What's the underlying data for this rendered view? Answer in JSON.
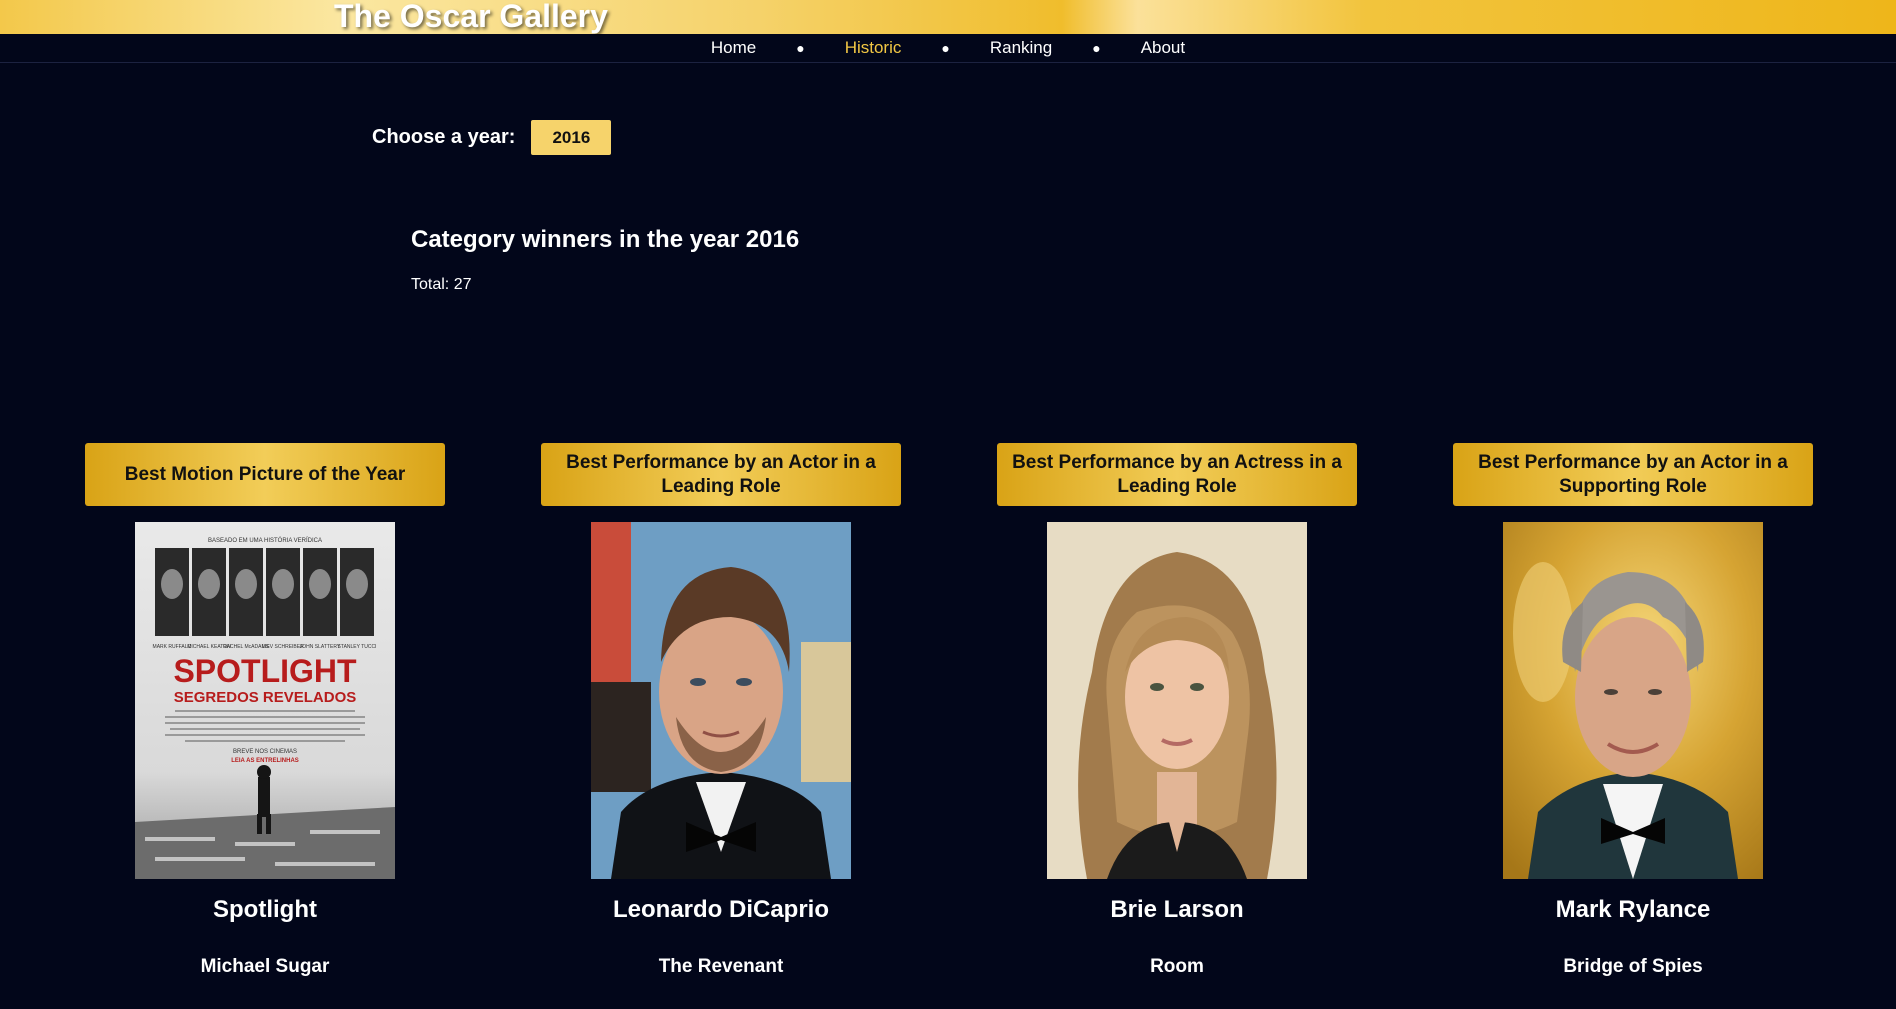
{
  "site": {
    "title": "The Oscar Gallery"
  },
  "nav": {
    "items": [
      {
        "label": "Home",
        "active": false
      },
      {
        "label": "Historic",
        "active": true
      },
      {
        "label": "Ranking",
        "active": false
      },
      {
        "label": "About",
        "active": false
      }
    ]
  },
  "filter": {
    "label": "Choose a year:",
    "selected_year": "2016"
  },
  "results": {
    "title": "Category winners in the year 2016",
    "total": "Total: 27"
  },
  "cards": [
    {
      "category": "Best Motion Picture of the Year",
      "name": "Spotlight",
      "subtitle": "Michael Sugar"
    },
    {
      "category": "Best Performance by an Actor in a Leading Role",
      "name": "Leonardo DiCaprio",
      "subtitle": "The Revenant"
    },
    {
      "category": "Best Performance by an Actress in a Leading Role",
      "name": "Brie Larson",
      "subtitle": "Room"
    },
    {
      "category": "Best Performance by an Actor in a Supporting Role",
      "name": "Mark Rylance",
      "subtitle": "Bridge of Spies"
    }
  ],
  "poster": {
    "top_text": "BASEADO EM UMA HISTÓRIA VERÍDICA",
    "title": "SPOTLIGHT",
    "subtitle": "SEGREDOS REVELADOS",
    "cast": [
      "MARK RUFFALO",
      "MICHAEL KEATON",
      "RACHEL McADAMS",
      "LIEV SCHREIBER",
      "JOHN SLATTERY",
      "STANLEY TUCCI"
    ],
    "tagline": "LEIA AS ENTRELINHAS",
    "release": "BREVE NOS CINEMAS"
  },
  "colors": {
    "background": "#02061a",
    "accent": "#f2c744",
    "card_header": "#e0ac20"
  }
}
